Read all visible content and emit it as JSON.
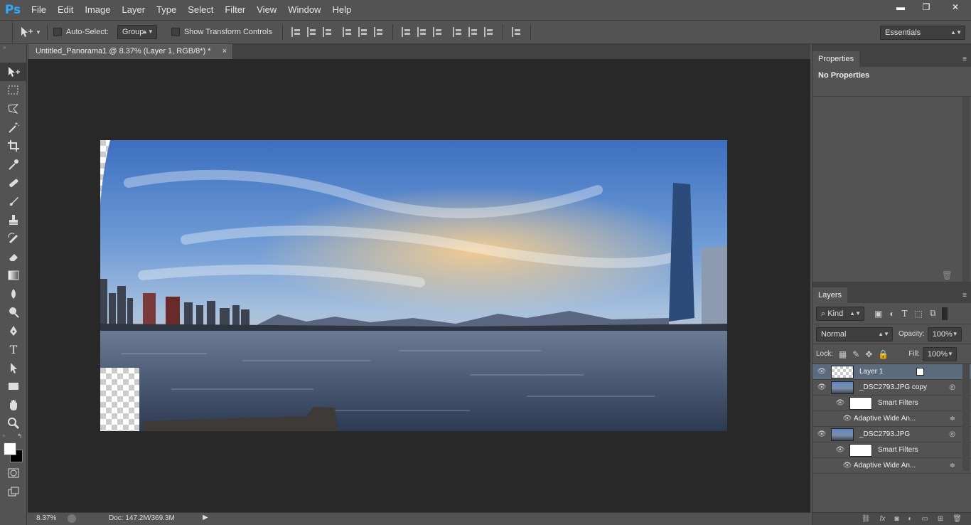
{
  "app": {
    "logo": "Ps"
  },
  "menu": [
    "File",
    "Edit",
    "Image",
    "Layer",
    "Type",
    "Select",
    "Filter",
    "View",
    "Window",
    "Help"
  ],
  "window_controls": {
    "minimize": "▬",
    "restore": "❐",
    "close": "✕"
  },
  "options": {
    "auto_select_label": "Auto-Select:",
    "auto_select_value": "Group",
    "show_transform_label": "Show Transform Controls",
    "workspace": "Essentials"
  },
  "document": {
    "tab_title": "Untitled_Panorama1 @ 8.37% (Layer 1, RGB/8*) *",
    "tab_close": "×"
  },
  "status": {
    "zoom": "8.37%",
    "doc_info": "Doc: 147.2M/369.3M"
  },
  "properties": {
    "tab": "Properties",
    "message": "No Properties"
  },
  "layers_panel": {
    "tab": "Layers",
    "filter_kind": "Kind",
    "blend_mode": "Normal",
    "opacity_label": "Opacity:",
    "opacity": "100%",
    "lock_label": "Lock:",
    "fill_label": "Fill:",
    "fill": "100%",
    "layers": [
      {
        "name": "Layer 1"
      },
      {
        "name": "_DSC2793.JPG copy",
        "smart_filters": "Smart Filters",
        "filter": "Adaptive Wide An..."
      },
      {
        "name": "_DSC2793.JPG",
        "smart_filters": "Smart Filters",
        "filter": "Adaptive Wide An..."
      }
    ]
  },
  "colors": {
    "accent": "#31a8ff",
    "selected_layer": "#5c6a7d"
  }
}
